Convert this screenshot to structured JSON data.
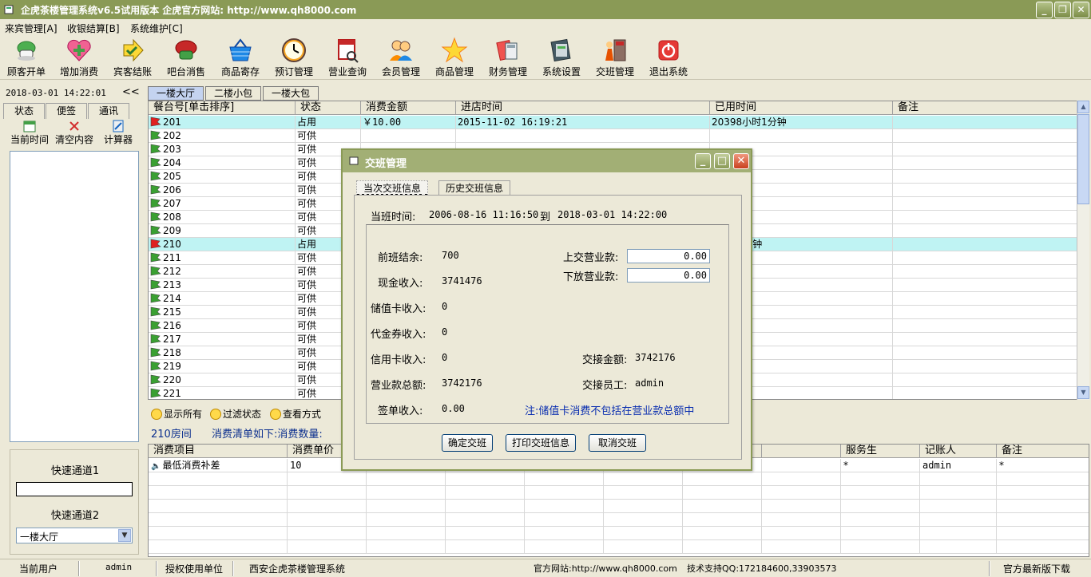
{
  "window": {
    "title": "企虎茶楼管理系统v6.5试用版本 企虎官方网站: http://www.qh8000.com",
    "min_label": "_",
    "restore_label": "❐",
    "close_label": "✕"
  },
  "menu": [
    {
      "label": "来宾管理[A]"
    },
    {
      "label": "收银结算[B]"
    },
    {
      "label": "系统维护[C]"
    }
  ],
  "toolbar": [
    {
      "label": "顾客开单",
      "icon": "teacup-icon"
    },
    {
      "label": "增加消费",
      "icon": "add-heart-icon"
    },
    {
      "label": "宾客结账",
      "icon": "checkout-arrow-icon"
    },
    {
      "label": "吧台消售",
      "icon": "bar-cup-icon"
    },
    {
      "label": "商品寄存",
      "icon": "basket-icon"
    },
    {
      "label": "预订管理",
      "icon": "clock-icon"
    },
    {
      "label": "营业查询",
      "icon": "calendar-search-icon"
    },
    {
      "label": "会员管理",
      "icon": "members-icon"
    },
    {
      "label": "商品管理",
      "icon": "star-icon"
    },
    {
      "label": "财务管理",
      "icon": "calculator-icon"
    },
    {
      "label": "系统设置",
      "icon": "settings-book-icon"
    },
    {
      "label": "交班管理",
      "icon": "shift-exit-icon"
    },
    {
      "label": "退出系统",
      "icon": "power-icon"
    }
  ],
  "left": {
    "clock": "2018-03-01 14:22:01",
    "collapse": "<<",
    "tabs": [
      "状态",
      "便签",
      "通讯"
    ],
    "tools": [
      {
        "label": "当前时间",
        "icon": "calendar-icon"
      },
      {
        "label": "清空内容",
        "icon": "clear-x-icon"
      },
      {
        "label": "计算器",
        "icon": "calculator-icon"
      }
    ],
    "quick1_label": "快速通道1",
    "quick2_label": "快速通道2",
    "quick2_value": "一楼大厅"
  },
  "area_tabs": [
    "一楼大厅",
    "二楼小包",
    "一楼大包"
  ],
  "grid": {
    "headers": [
      "餐台号[单击排序]",
      "状态",
      "消费金额",
      "进店时间",
      "已用时间",
      "备注"
    ],
    "rows": [
      {
        "table": "201",
        "status": "占用",
        "amount": "￥10.00",
        "checkin": "2015-11-02 16:19:21",
        "elapsed": "20398小时1分钟",
        "note": "",
        "occupied": true
      },
      {
        "table": "202",
        "status": "可供",
        "amount": "",
        "checkin": "",
        "elapsed": "",
        "note": "",
        "occupied": false
      },
      {
        "table": "203",
        "status": "可供",
        "amount": "",
        "checkin": "",
        "elapsed": "",
        "note": "",
        "occupied": false
      },
      {
        "table": "204",
        "status": "可供",
        "amount": "",
        "checkin": "",
        "elapsed": "",
        "note": "",
        "occupied": false
      },
      {
        "table": "205",
        "status": "可供",
        "amount": "",
        "checkin": "",
        "elapsed": "",
        "note": "",
        "occupied": false
      },
      {
        "table": "206",
        "status": "可供",
        "amount": "",
        "checkin": "",
        "elapsed": "",
        "note": "",
        "occupied": false
      },
      {
        "table": "207",
        "status": "可供",
        "amount": "",
        "checkin": "",
        "elapsed": "",
        "note": "",
        "occupied": false
      },
      {
        "table": "208",
        "status": "可供",
        "amount": "",
        "checkin": "",
        "elapsed": "",
        "note": "",
        "occupied": false
      },
      {
        "table": "209",
        "status": "可供",
        "amount": "",
        "checkin": "",
        "elapsed": "",
        "note": "",
        "occupied": false
      },
      {
        "table": "210",
        "status": "占用",
        "amount": "",
        "checkin": "",
        "elapsed": "小时31分钟",
        "note": "",
        "occupied": true
      },
      {
        "table": "211",
        "status": "可供",
        "amount": "",
        "checkin": "",
        "elapsed": "",
        "note": "",
        "occupied": false
      },
      {
        "table": "212",
        "status": "可供",
        "amount": "",
        "checkin": "",
        "elapsed": "",
        "note": "",
        "occupied": false
      },
      {
        "table": "213",
        "status": "可供",
        "amount": "",
        "checkin": "",
        "elapsed": "",
        "note": "",
        "occupied": false
      },
      {
        "table": "214",
        "status": "可供",
        "amount": "",
        "checkin": "",
        "elapsed": "",
        "note": "",
        "occupied": false
      },
      {
        "table": "215",
        "status": "可供",
        "amount": "",
        "checkin": "",
        "elapsed": "",
        "note": "",
        "occupied": false
      },
      {
        "table": "216",
        "status": "可供",
        "amount": "",
        "checkin": "",
        "elapsed": "",
        "note": "",
        "occupied": false
      },
      {
        "table": "217",
        "status": "可供",
        "amount": "",
        "checkin": "",
        "elapsed": "",
        "note": "",
        "occupied": false
      },
      {
        "table": "218",
        "status": "可供",
        "amount": "",
        "checkin": "",
        "elapsed": "",
        "note": "",
        "occupied": false
      },
      {
        "table": "219",
        "status": "可供",
        "amount": "",
        "checkin": "",
        "elapsed": "",
        "note": "",
        "occupied": false
      },
      {
        "table": "220",
        "status": "可供",
        "amount": "",
        "checkin": "",
        "elapsed": "",
        "note": "",
        "occupied": false
      },
      {
        "table": "221",
        "status": "可供",
        "amount": "",
        "checkin": "",
        "elapsed": "",
        "note": "",
        "occupied": false
      }
    ]
  },
  "filters": [
    "显示所有",
    "过滤状态",
    "查看方式"
  ],
  "room_info": "210房间",
  "consume_info": "消费清单如下:消费数量:",
  "bottom_grid": {
    "headers": [
      "消费项目",
      "消费单价",
      "",
      "",
      "",
      "",
      "",
      "",
      "服务生",
      "记账人",
      "备注"
    ],
    "rows": [
      {
        "item": "最低消费补差",
        "price": "10",
        "waiter": "*",
        "recorder": "admin",
        "note": "*"
      }
    ]
  },
  "status": {
    "user_label": "当前用户",
    "user": "admin",
    "licensee_label": "授权使用单位",
    "licensee": "西安企虎茶楼管理系统",
    "website": "官方网站:http://www.qh8000.com",
    "support": "技术支持QQ:172184600,33903573",
    "download": "官方最新版下载"
  },
  "dialog": {
    "title": "交班管理",
    "tabs": [
      "当次交班信息",
      "历史交班信息"
    ],
    "shift_label": "当班时间:",
    "shift_start": "2006-08-16 11:16:50",
    "shift_to": "到",
    "shift_end": "2018-03-01 14:22:00",
    "prev_balance_label": "前班结余:",
    "prev_balance": "700",
    "cash_label": "现金收入:",
    "cash": "3741476",
    "stored_card_label": "储值卡收入:",
    "stored_card": "0",
    "voucher_label": "代金券收入:",
    "voucher": "0",
    "credit_card_label": "信用卡收入:",
    "credit_card": "0",
    "revenue_total_label": "营业款总额:",
    "revenue_total": "3742176",
    "sign_bill_label": "签单收入:",
    "sign_bill": "0.00",
    "handover_label": "上交营业款:",
    "handover": "0.00",
    "release_label": "下放营业款:",
    "release": "0.00",
    "transfer_amount_label": "交接金额:",
    "transfer_amount": "3742176",
    "transfer_staff_label": "交接员工:",
    "transfer_staff": "admin",
    "note": "注:储值卡消费不包括在营业款总额中",
    "btn_confirm": "确定交班",
    "btn_print": "打印交班信息",
    "btn_cancel": "取消交班"
  }
}
